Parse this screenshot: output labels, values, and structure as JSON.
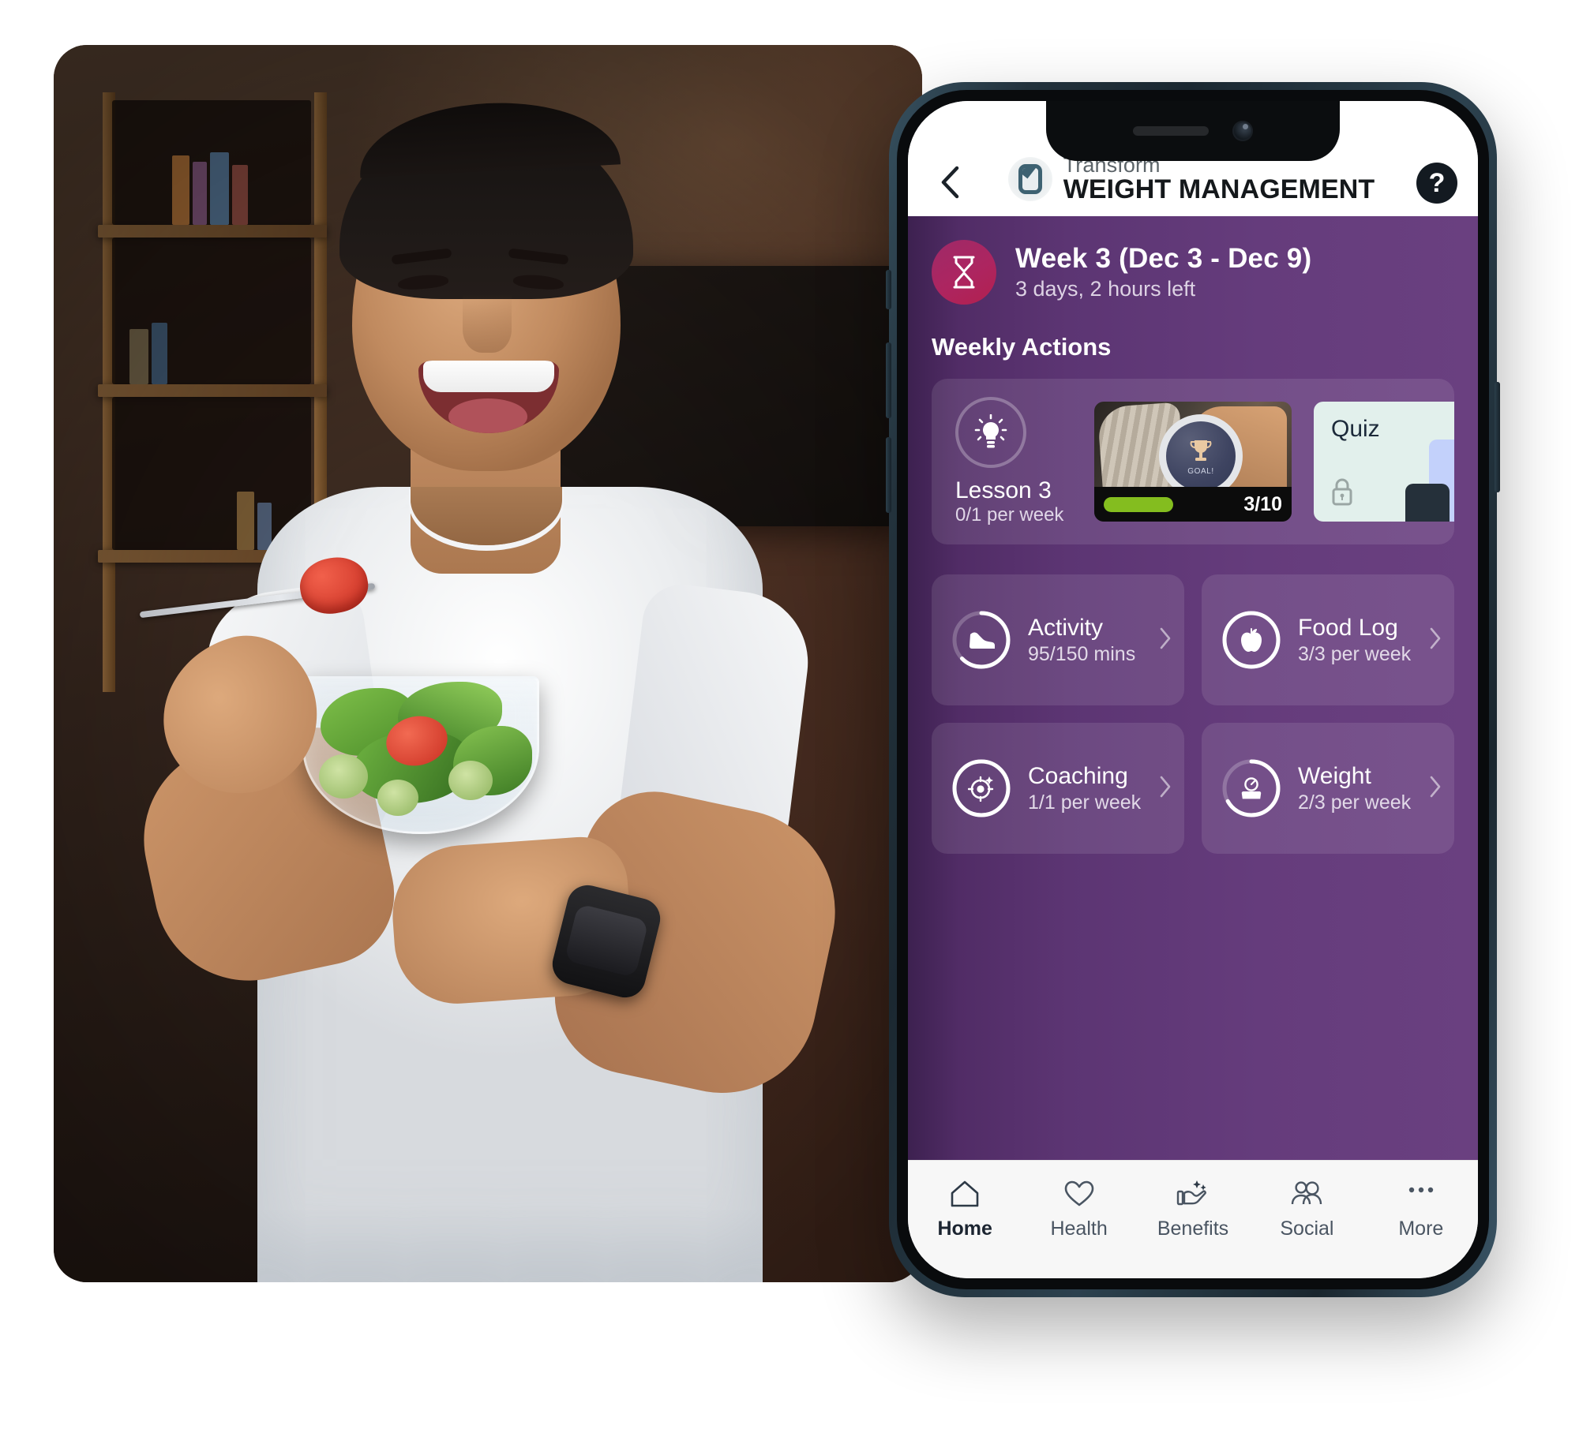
{
  "photo": {
    "alt": "man-eating-salad-photo",
    "description": "Smiling man holding a glass bowl of salad with a fork"
  },
  "phone": {
    "notch": {
      "speaker": "speaker-grille",
      "camera": "front-camera"
    },
    "buttons": [
      "silent-switch",
      "volume-up",
      "volume-down",
      "power-button"
    ]
  },
  "header": {
    "back_icon": "chevron-left-icon",
    "logo_icon": "transform-logo-icon",
    "brand_top": "Transform",
    "brand_bottom": "WEIGHT MANAGEMENT",
    "help_label": "?",
    "help_icon": "question-circle-icon"
  },
  "week_banner": {
    "icon": "hourglass-icon",
    "title": "Week 3 (Dec 3 - Dec 9)",
    "subtitle": "3 days, 2 hours left",
    "accent_color": "#ad2560"
  },
  "section": {
    "title": "Weekly Actions"
  },
  "lesson": {
    "icon": "lightbulb-icon",
    "name": "Lesson 3",
    "frequency": "0/1 per week",
    "progress": 0,
    "progress_max": 1
  },
  "video": {
    "thumb_icon": "smartwatch-trophy-thumbnail",
    "watch_trophy_icon": "trophy-icon",
    "watch_caption": "GOAL!",
    "count": "3/10",
    "progress_color": "#84bd1f",
    "progress_current": 3,
    "progress_total": 10
  },
  "quiz": {
    "label": "Quiz",
    "lock_icon": "lock-icon",
    "locked": true,
    "background_color": "#e2f0ec"
  },
  "tiles": [
    {
      "name": "Activity",
      "sub": "95/150 mins",
      "icon": "shoe-icon",
      "chevron_icon": "chevron-right-icon",
      "progress": 95,
      "total": 150,
      "percent": 63
    },
    {
      "name": "Food Log",
      "sub": "3/3 per week",
      "icon": "apple-icon",
      "chevron_icon": "chevron-right-icon",
      "progress": 3,
      "total": 3,
      "percent": 100
    },
    {
      "name": "Coaching",
      "sub": "1/1 per week",
      "icon": "target-icon",
      "chevron_icon": "chevron-right-icon",
      "progress": 1,
      "total": 1,
      "percent": 100
    },
    {
      "name": "Weight",
      "sub": "2/3 per week",
      "icon": "scale-icon",
      "chevron_icon": "chevron-right-icon",
      "progress": 2,
      "total": 3,
      "percent": 67
    }
  ],
  "bottom_nav": [
    {
      "label": "Home",
      "icon": "home-icon",
      "active": true
    },
    {
      "label": "Health",
      "icon": "heart-icon",
      "active": false
    },
    {
      "label": "Benefits",
      "icon": "hand-sparkle-icon",
      "active": false
    },
    {
      "label": "Social",
      "icon": "people-icon",
      "active": false
    },
    {
      "label": "More",
      "icon": "ellipsis-icon",
      "active": false
    }
  ],
  "theme": {
    "purple_dark": "#3d2150",
    "purple_mid": "#5c3573",
    "purple_light": "#6a4080",
    "magenta": "#ad2560",
    "green": "#84bd1f",
    "phone_frame": "#2c414e"
  }
}
